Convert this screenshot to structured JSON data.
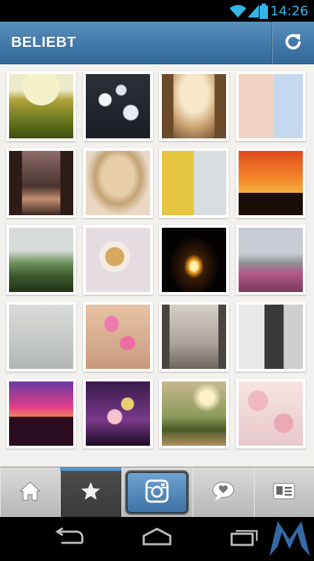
{
  "status_bar": {
    "time": "14:26",
    "accent_color": "#33b5e5"
  },
  "app_bar": {
    "title": "BELIEBT",
    "refresh_icon": "refresh-icon"
  },
  "grid": {
    "columns": 4,
    "photos": [
      {
        "name": "photo-rapeseed-field",
        "bg": "radial-gradient(circle at 50% 20%, #f4f2c8 0 30%, transparent 31%), linear-gradient(#eceacb 0 25%, #b0a33a 40%, #6b7b1e 70%, #3e4e12)"
      },
      {
        "name": "photo-white-flowers-dark",
        "bg": "radial-gradient(circle at 30% 40%, #f2f4f6 0 10%, transparent 12%), radial-gradient(circle at 70% 60%, #e8ecf0 0 12%, transparent 14%), radial-gradient(circle at 55% 25%, #dfe4ea 0 8%, transparent 10%), linear-gradient(#2a3036, #1a1e24)"
      },
      {
        "name": "photo-church-interior",
        "bg": "linear-gradient(90deg, #6b4a2a 0 18%, transparent 18% 82%, #6b4a2a 82%), radial-gradient(ellipse at 50% 30%, #f6e8c8 0 30%, #c9a070 55%, #4a2a18)"
      },
      {
        "name": "photo-girl-collage",
        "bg": "linear-gradient(90deg, #f0d4c4 0 55%, #c4d8ee 55%), linear-gradient(#d9b8a8, #8aa0c8)"
      },
      {
        "name": "photo-city-street",
        "bg": "linear-gradient(90deg, #2d1c18 0 20%, transparent 20% 80%, #2d1c18 80%), linear-gradient(#8c6d6a, #4a3430 55%, #c58f70 75%, #3a2a24)"
      },
      {
        "name": "photo-braided-hair",
        "bg": "radial-gradient(ellipse at 50% 40%, #e6cfa8 0 35%, #c3a274 50%, #ead8c4 70%)"
      },
      {
        "name": "photo-boys-ok-collage",
        "bg": "linear-gradient(90deg, #e6c640 0 50%, #d9dde2 50%), linear-gradient(#f2f2f2, #b0b0b0)"
      },
      {
        "name": "photo-sunset-cranes",
        "bg": "linear-gradient(transparent 0 65%, #1a0e08 65%), linear-gradient(#e14a1e, #f28a2a 45%, #f6b040 65%)"
      },
      {
        "name": "photo-park-river",
        "bg": "linear-gradient(#d7dcd8 0 35%, #6d8f5a 55%, #3c5a2c 75%, #203018)"
      },
      {
        "name": "photo-cereal-bowl",
        "bg": "radial-gradient(circle at 45% 45%, #d6a860 0 18%, #f3ece4 20% 30%, #e4dce0 32%)"
      },
      {
        "name": "photo-sparkler-cake",
        "bg": "radial-gradient(ellipse at 50% 60%, #fff2b0 0 8%, #f0a020 12%, #3a1e08 22%, #050302 55%)"
      },
      {
        "name": "photo-notre-dame-blossoms",
        "bg": "linear-gradient(#c8ccd2 0 40%, #8d8f93 55%, #b45a8c 70%, #7a3a5c)"
      },
      {
        "name": "photo-torii-lake",
        "bg": "linear-gradient(#d9dcd8, #c6cac8 50%, #b2b6b4)"
      },
      {
        "name": "photo-pink-nails",
        "bg": "radial-gradient(ellipse at 40% 30%, #f07ab0 0 12%, transparent 14%), radial-gradient(ellipse at 65% 60%, #ee6ca4 0 12%, transparent 14%), linear-gradient(#e7c3a4, #c99a7c)"
      },
      {
        "name": "photo-bare-trees-mist",
        "bg": "linear-gradient(90deg, #4a4440 0 12%, transparent 12% 88%, #4a4440 88%), linear-gradient(#d6d0c8, #a9a39a 60%, #6e665e)"
      },
      {
        "name": "photo-girl-bw",
        "bg": "linear-gradient(90deg, #e8e8e8 0 40%, #3a3a3a 40% 70%, #cfcfcf 70%)"
      },
      {
        "name": "photo-pink-sunset-trees",
        "bg": "linear-gradient(transparent 0 55%, #2a0c1e 55%), linear-gradient(#6a3aa0, #e23e8a 40%, #f59a4a 60%)"
      },
      {
        "name": "photo-cherry-blossom-bokeh",
        "bg": "radial-gradient(circle at 45% 55%, #f6c2d0 0 14%, transparent 16%), radial-gradient(circle at 65% 35%, #e8d070 0 10%, transparent 12%), linear-gradient(#3a1a4a, #7a3a8a 60%, #1a0a24)"
      },
      {
        "name": "photo-sunset-road-trees",
        "bg": "radial-gradient(circle at 70% 25%, #fff2c8 0 10%, transparent 22%), linear-gradient(#c8b890, #8a9a5a 55%, #4a5a28 75%, #b09060)"
      },
      {
        "name": "photo-cherry-blossoms",
        "bg": "radial-gradient(circle at 30% 30%, #f0b8c0 0 15%, transparent 17%), radial-gradient(circle at 70% 65%, #eaa8b4 0 15%, transparent 17%), linear-gradient(#f6e4e2, #e8c8cc)"
      }
    ]
  },
  "tab_bar": {
    "tabs": [
      {
        "name": "tab-home",
        "icon": "home-icon",
        "active": false
      },
      {
        "name": "tab-popular",
        "icon": "star-icon",
        "active": true
      },
      {
        "name": "tab-camera",
        "icon": "camera-icon",
        "active": false
      },
      {
        "name": "tab-news",
        "icon": "speech-bubble-heart-icon",
        "active": false
      },
      {
        "name": "tab-profile",
        "icon": "profile-card-icon",
        "active": false
      }
    ],
    "active_indicator_color": "#5594c8"
  },
  "nav_bar": {
    "buttons": [
      "back-icon",
      "home-outline-icon",
      "recent-apps-icon"
    ]
  }
}
